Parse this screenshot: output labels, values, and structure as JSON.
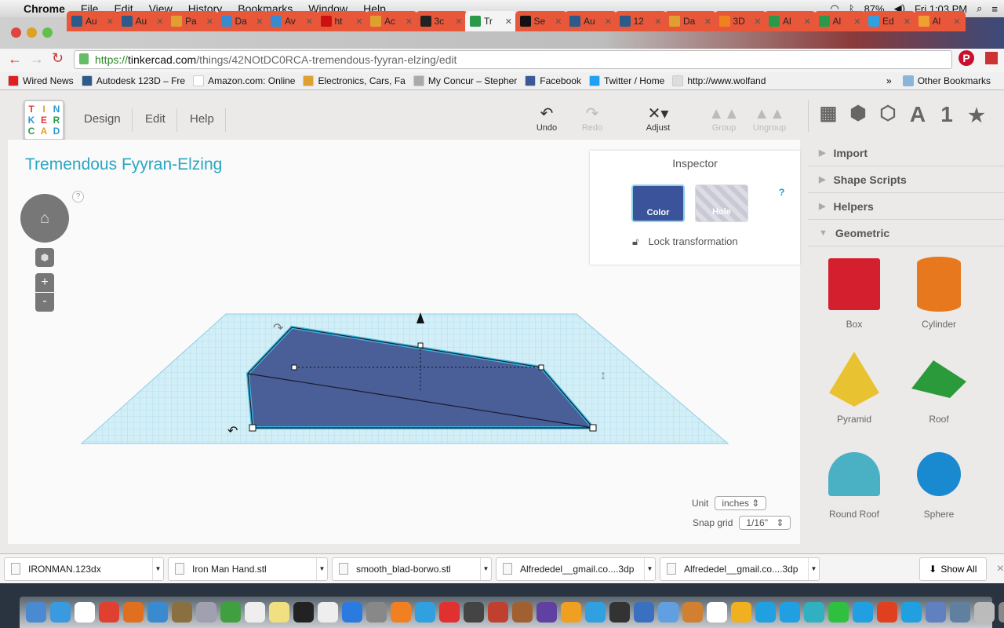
{
  "menubar": {
    "app": "Chrome",
    "items": [
      "File",
      "Edit",
      "View",
      "History",
      "Bookmarks",
      "Window",
      "Help"
    ],
    "battery": "87%",
    "clock": "Fri 1:03 PM"
  },
  "tabs": [
    {
      "label": "Au",
      "color": "#2c5a8a"
    },
    {
      "label": "Au",
      "color": "#2c5a8a"
    },
    {
      "label": "Pa",
      "color": "#e0a030"
    },
    {
      "label": "Da",
      "color": "#3a8ad0"
    },
    {
      "label": "Av",
      "color": "#3a8ad0"
    },
    {
      "label": "ht",
      "color": "#cc1111"
    },
    {
      "label": "Ac",
      "color": "#e0a030"
    },
    {
      "label": "3c",
      "color": "#222222"
    },
    {
      "label": "Tr",
      "color": "#2a9a4a",
      "active": true
    },
    {
      "label": "Se",
      "color": "#111111"
    },
    {
      "label": "Au",
      "color": "#2c5a8a"
    },
    {
      "label": "12",
      "color": "#2c5a8a"
    },
    {
      "label": "Da",
      "color": "#e0a030"
    },
    {
      "label": "3D",
      "color": "#f08020"
    },
    {
      "label": "Al",
      "color": "#2a9a4a"
    },
    {
      "label": "Al",
      "color": "#2a9a4a"
    },
    {
      "label": "Ed",
      "color": "#30a0e0"
    },
    {
      "label": "Al",
      "color": "#f0a030"
    }
  ],
  "omnibox": {
    "scheme": "https://",
    "host": "tinkercad.com",
    "path": "/things/42NOtDC0RCA-tremendous-fyyran-elzing/edit"
  },
  "bookmarks": [
    {
      "label": "Wired News",
      "color": "#e02020"
    },
    {
      "label": "Autodesk 123D – Fre",
      "color": "#2c5a8a"
    },
    {
      "label": "Amazon.com: Online",
      "color": "#ffffff"
    },
    {
      "label": "Electronics, Cars, Fa",
      "color": "#e0a030"
    },
    {
      "label": "My Concur – Stepher",
      "color": "#aaaaaa"
    },
    {
      "label": "Facebook",
      "color": "#3b5998"
    },
    {
      "label": "Twitter / Home",
      "color": "#1da1f2"
    },
    {
      "label": "http://www.wolfand",
      "color": "#dddddd"
    }
  ],
  "bookmarks_more": "»",
  "other_bookmarks": "Other Bookmarks",
  "logo": [
    "T",
    "I",
    "N",
    "K",
    "E",
    "R",
    "C",
    "A",
    "D"
  ],
  "nav": [
    "Design",
    "Edit",
    "Help"
  ],
  "toolbar": {
    "undo": "Undo",
    "redo": "Redo",
    "adjust": "Adjust",
    "group": "Group",
    "ungroup": "Ungroup"
  },
  "views": {
    "text": "A",
    "number": "1",
    "star": "★"
  },
  "design_title": "Tremendous Fyyran-Elzing",
  "help_q": "?",
  "inspector": {
    "title": "Inspector",
    "color": "Color",
    "hole": "Hole",
    "help": "?",
    "lock": "Lock transformation",
    "swatch": "#3a539b"
  },
  "panel": {
    "sections": [
      {
        "label": "Import",
        "open": false
      },
      {
        "label": "Shape Scripts",
        "open": false
      },
      {
        "label": "Helpers",
        "open": false
      },
      {
        "label": "Geometric",
        "open": true
      }
    ],
    "shapes": [
      {
        "label": "Box",
        "color": "#d4202e"
      },
      {
        "label": "Cylinder",
        "color": "#e8781e"
      },
      {
        "label": "Pyramid",
        "color": "#e8c230"
      },
      {
        "label": "Roof",
        "color": "#2a9a3a"
      },
      {
        "label": "Round Roof",
        "color": "#4ab0c4"
      },
      {
        "label": "Sphere",
        "color": "#1a8ad0"
      }
    ]
  },
  "settings": {
    "unit_label": "Unit",
    "unit": "inches",
    "snap_label": "Snap grid",
    "snap": "1/16\""
  },
  "downloads": {
    "items": [
      "IRONMAN.123dx",
      "Iron Man Hand.stl",
      "smooth_blad-borwo.stl",
      "Alfrededel__gmail.co....3dp",
      "Alfrededel__gmail.co....3dp"
    ],
    "show_all": "Show All",
    "close": "×"
  },
  "dock_colors": [
    "#4a8ad0",
    "#3a9ae0",
    "#ffffff",
    "#e04030",
    "#e07020",
    "#3a8ad0",
    "#8a7040",
    "#a0a0b0",
    "#40a040",
    "#eeeeee",
    "#f0e080",
    "#222222",
    "#eeeeee",
    "#2a7ae0",
    "#888888",
    "#f08020",
    "#30a0e0",
    "#e03030",
    "#444444",
    "#c04030",
    "#a06030",
    "#6040a0",
    "#f0a020",
    "#30a0e0",
    "#333333",
    "#3a70c0",
    "#60a0e0",
    "#d08030",
    "#ffffff",
    "#f0b020",
    "#20a0e0",
    "#20a0e0",
    "#30b0c0",
    "#30c040",
    "#20a0e0",
    "#e04020",
    "#20a0e0",
    "#6080c0",
    "#6080a0",
    "#bbbbbb",
    "#888888"
  ]
}
